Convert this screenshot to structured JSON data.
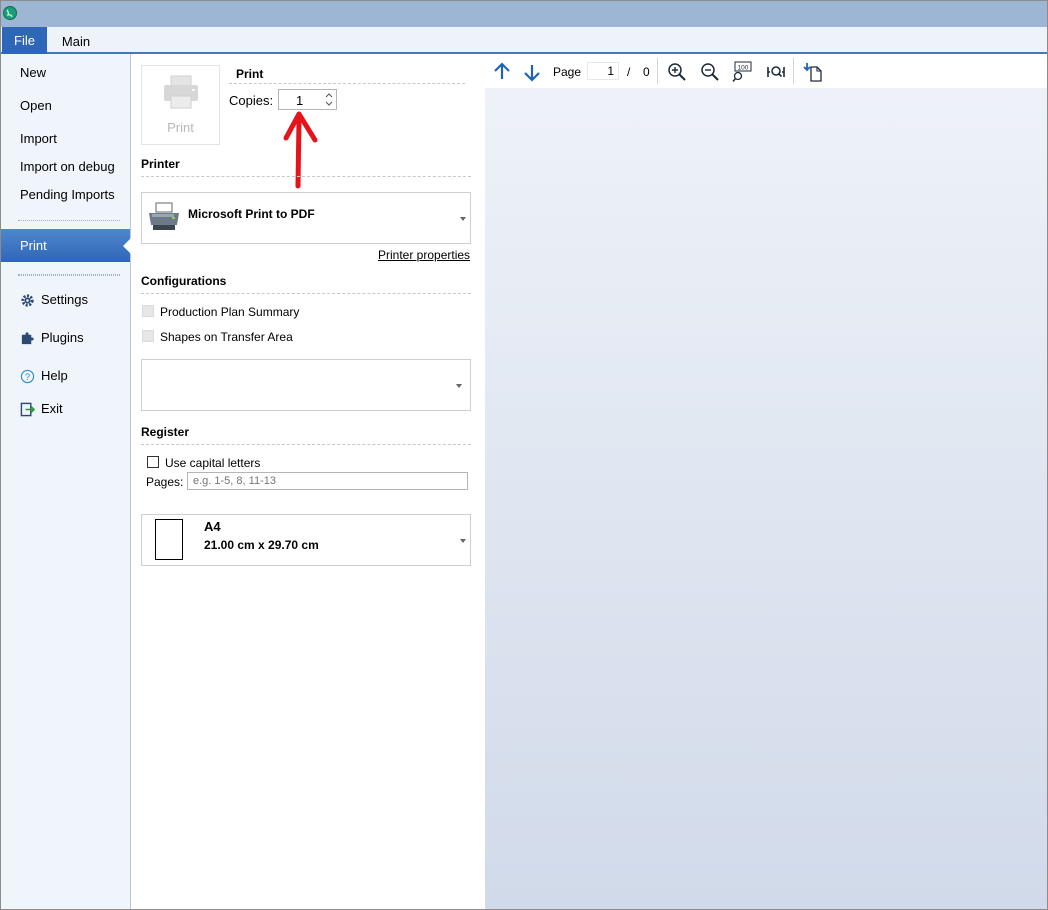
{
  "tabs": {
    "file": "File",
    "main": "Main"
  },
  "nav": {
    "new": "New",
    "open": "Open",
    "import": "Import",
    "import_debug": "Import on debug",
    "pending_imports": "Pending Imports",
    "print": "Print",
    "settings": "Settings",
    "plugins": "Plugins",
    "help": "Help",
    "exit": "Exit"
  },
  "print_section": {
    "heading": "Print",
    "button_label": "Print",
    "copies_label": "Copies:",
    "copies_value": "1"
  },
  "printer": {
    "heading": "Printer",
    "name": "Microsoft Print to PDF",
    "properties_link": "Printer properties"
  },
  "configurations": {
    "heading": "Configurations",
    "items": [
      "Production Plan Summary",
      "Shapes on Transfer Area"
    ],
    "dropdown_value": ""
  },
  "register": {
    "heading": "Register",
    "capital_letters": "Use capital letters",
    "capital_checked": false,
    "pages_label": "Pages:",
    "pages_placeholder": "e.g. 1-5, 8, 11-13"
  },
  "paper": {
    "name": "A4",
    "size": "21.00 cm x 29.70 cm"
  },
  "preview": {
    "page_label": "Page",
    "current_page": "1",
    "separator": "/",
    "total_pages": "0"
  },
  "colors": {
    "accent": "#2f67b8",
    "annotation_arrow": "#e5141b",
    "icon_blue": "#1f64b4"
  }
}
